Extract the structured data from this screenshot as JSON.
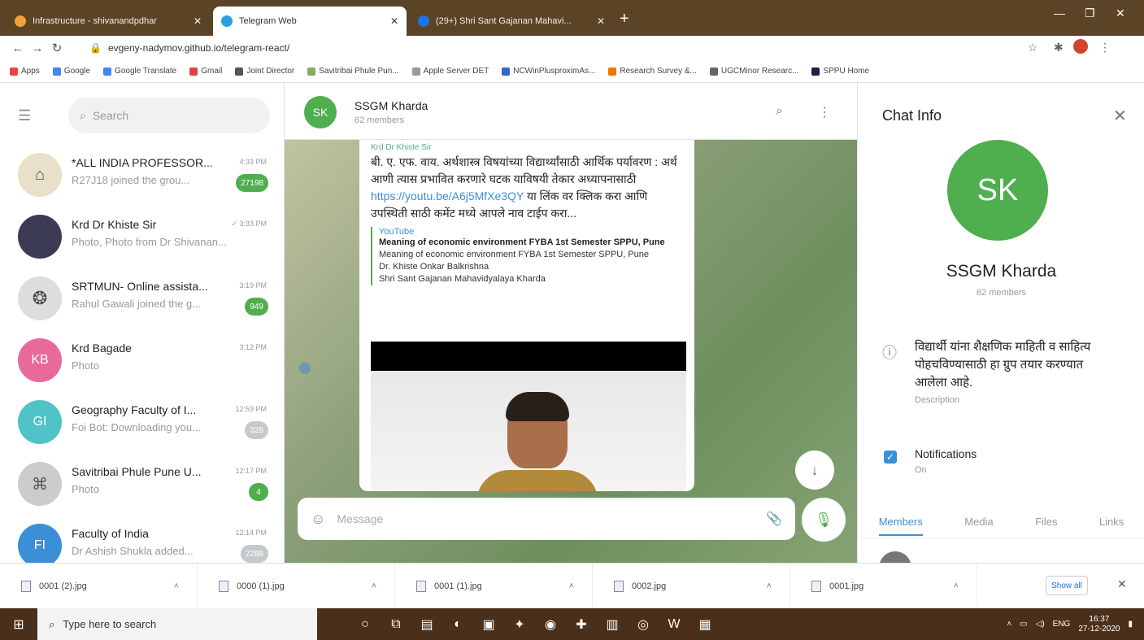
{
  "browser": {
    "tabs": [
      {
        "title": "Infrastructure - shivanandpdhar",
        "active": false,
        "color": "#f2a23c"
      },
      {
        "title": "Telegram Web",
        "active": true,
        "color": "#2aa1da"
      },
      {
        "title": "(29+) Shri Sant Gajanan Mahavi...",
        "active": false,
        "color": "#1a73e8"
      }
    ],
    "url": "evgeny-nadymov.github.io/telegram-react/",
    "bookmarks": [
      "Apps",
      "Google",
      "Google Translate",
      "Gmail",
      "Joint Director",
      "Savitribai Phule Pun...",
      "Apple Server DET",
      "NCWinPlusproximAs...",
      "Research Survey &...",
      "UGCMinor Researc...",
      "SPPU Home"
    ]
  },
  "sidebar": {
    "search_placeholder": "Search",
    "chats": [
      {
        "name": "*ALL INDIA PROFESSOR...",
        "preview": "R27J18 joined the grou...",
        "time": "4:33 PM",
        "badge": "27198",
        "badge_grey": false,
        "avatar_text": "",
        "avatar_color": "#e8e0c8"
      },
      {
        "name": "Krd Dr Khiste Sir",
        "preview": "Photo, Photo from Dr Shivanan...",
        "time": "✓ 3:33 PM",
        "badge": "",
        "badge_grey": false,
        "avatar_text": "",
        "avatar_color": "#3b3b55"
      },
      {
        "name": "SRTMUN- Online assista...",
        "preview": "Rahul Gawali joined the g...",
        "time": "3:19 PM",
        "badge": "949",
        "badge_grey": false,
        "avatar_text": "",
        "avatar_color": "#dddddd"
      },
      {
        "name": "Krd Bagade",
        "preview": "Photo",
        "time": "3:12 PM",
        "badge": "",
        "badge_grey": false,
        "avatar_text": "KB",
        "avatar_color": "#e86a9a"
      },
      {
        "name": "Geography Faculty of I...",
        "preview": "Foi Bot: Downloading you...",
        "time": "12:59 PM",
        "badge": "328",
        "badge_grey": true,
        "avatar_text": "GI",
        "avatar_color": "#4fc3c7"
      },
      {
        "name": "Savitribai Phule Pune U...",
        "preview": "Photo",
        "time": "12:17 PM",
        "badge": "4",
        "badge_grey": false,
        "avatar_text": "",
        "avatar_color": "#cccccc"
      },
      {
        "name": "Faculty of India",
        "preview": "Dr Ashish Shukla added...",
        "time": "12:14 PM",
        "badge": "2288",
        "badge_grey": true,
        "avatar_text": "FI",
        "avatar_color": "#3a8fd6"
      }
    ]
  },
  "chat": {
    "avatar": "SK",
    "title": "SSGM Kharda",
    "subtitle": "62 members",
    "from": "Krd Dr Khiste Sir",
    "text": "बी. ए. एफ. वाय. अर्थशास्त्र विषयांच्या विद्यार्थ्यांसाठी आर्थिक पर्यावरण : अर्थ आणी त्यास प्रभावित करणारे घटक याविषयी तेकार अध्यापनासाठी ",
    "link": "https://youtu.be/A6j5MfXe3QY",
    "text2": " या लिंक वर क्लिक करा आणि उपस्थिती साठी कमेंट मध्ये आपले नाव टाईप करा...",
    "preview_site": "YouTube",
    "preview_title": "Meaning of economic environment FYBA 1st Semester SPPU, Pune",
    "preview_desc": [
      "Meaning of economic environment FYBA 1st Semester SPPU, Pune",
      "Dr. Khiste Onkar Balkrishna",
      "Shri Sant Gajanan Mahavidyalaya Kharda"
    ],
    "message_placeholder": "Message"
  },
  "info": {
    "title": "Chat Info",
    "avatar": "SK",
    "name": "SSGM Kharda",
    "members": "62 members",
    "description": "विद्यार्थी यांना शैक्षणिक माहिती व साहित्य पोहचविण्यासाठी हा ग्रुप तयार करण्यात आलेला आहे.",
    "description_label": "Description",
    "notifications_label": "Notifications",
    "notifications_value": "On",
    "tabs": [
      "Members",
      "Media",
      "Files",
      "Links"
    ]
  },
  "downloads": {
    "items": [
      "0001 (2).jpg",
      "0000 (1).jpg",
      "0001 (1).jpg",
      "0002.jpg",
      "0001.jpg"
    ],
    "show_all": "Show all"
  },
  "taskbar": {
    "search_placeholder": "Type here to search",
    "lang": "ENG",
    "time": "16:37",
    "date": "27-12-2020"
  }
}
